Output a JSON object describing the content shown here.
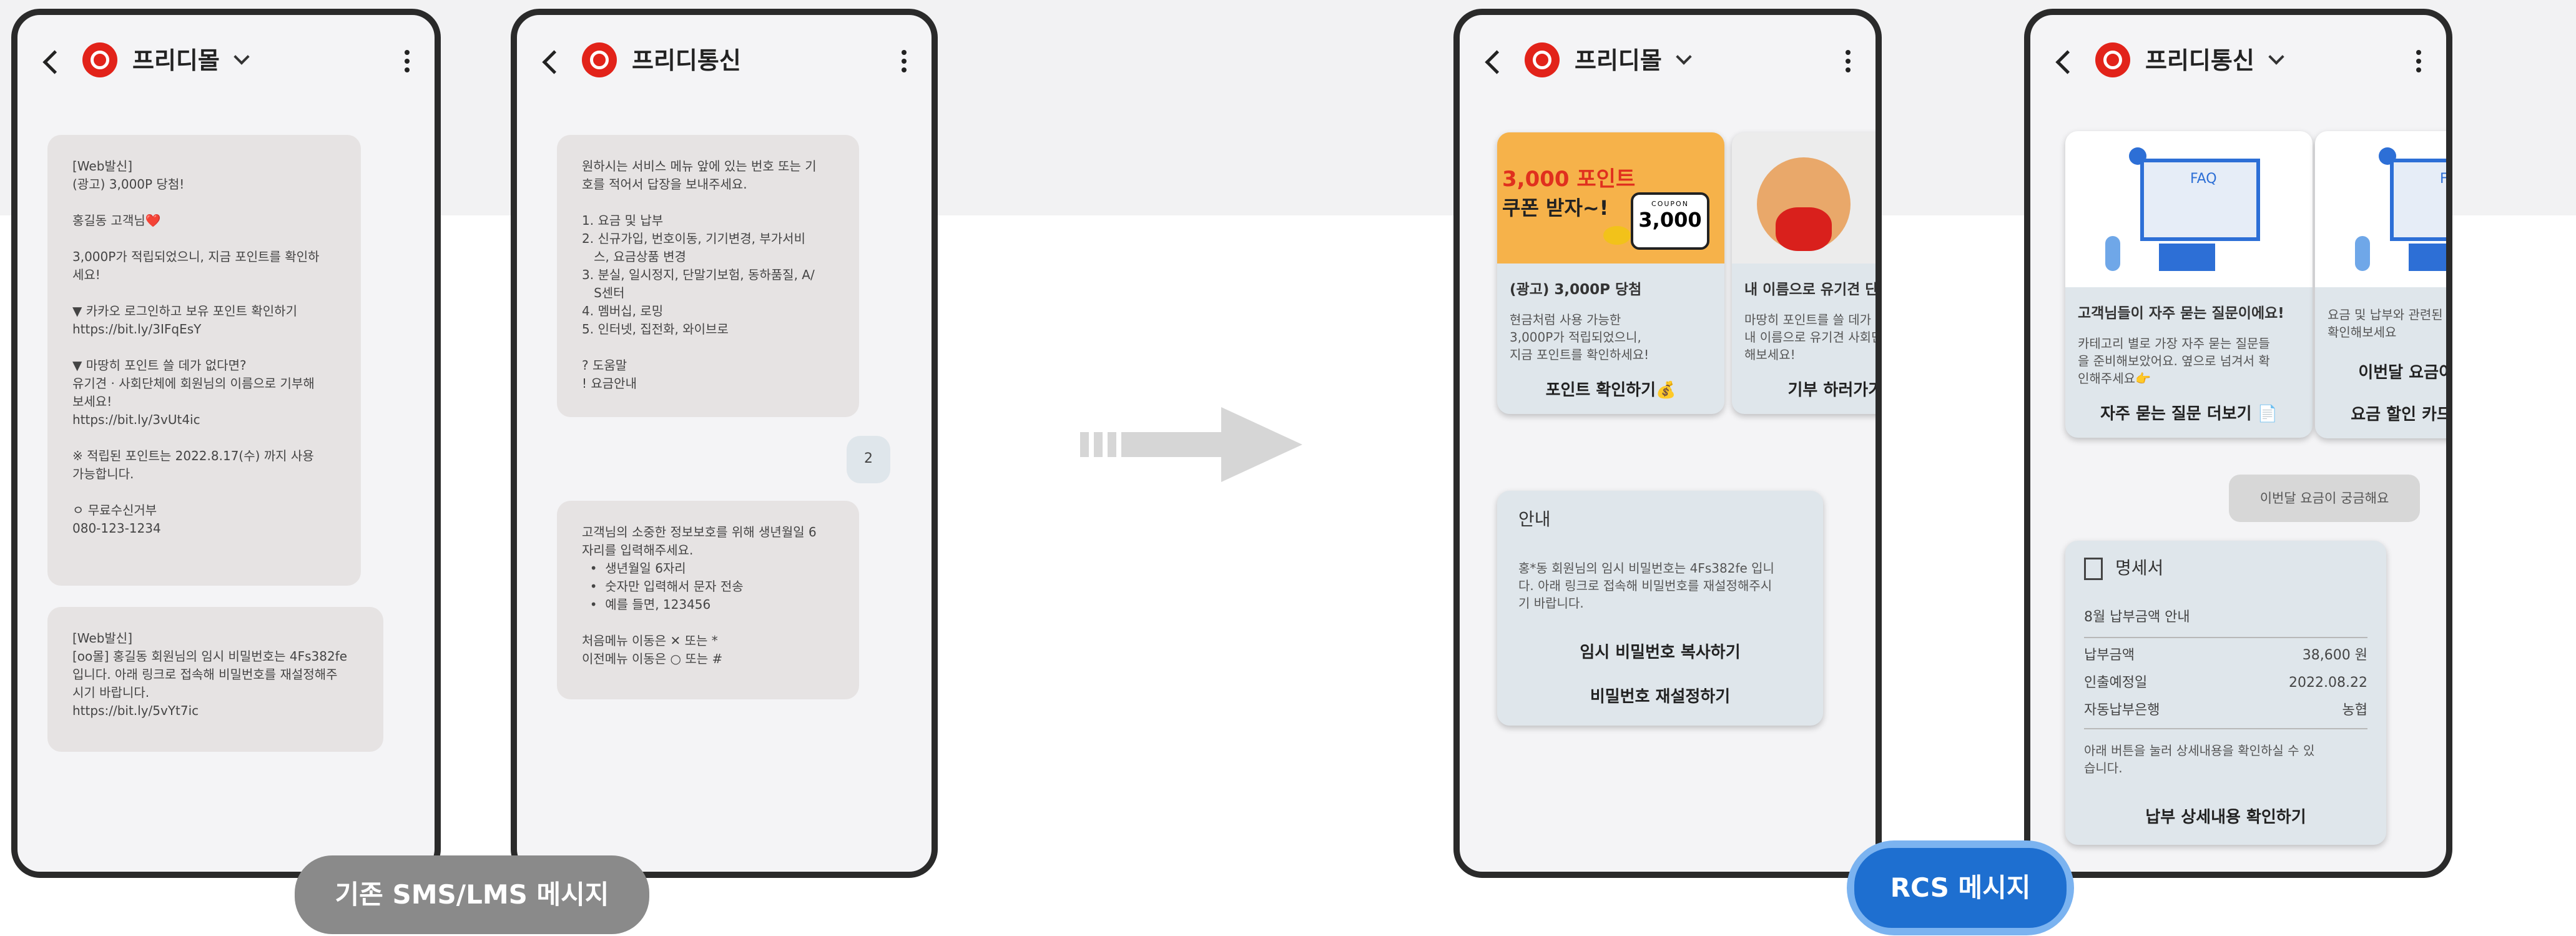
{
  "phones": [
    {
      "title": "프리디몰",
      "has_dropdown": true
    },
    {
      "title": "프리디통신",
      "has_dropdown": false
    },
    {
      "title": "프리디몰",
      "has_dropdown": true
    },
    {
      "title": "프리디통신",
      "has_dropdown": true
    }
  ],
  "sms1": {
    "lines": [
      "[Web발신]",
      "(광고) 3,000P 당첨!",
      "",
      "홍길동 고객님❤️",
      "",
      "3,000P가 적립되었으니, 지금 포인트를 확인하",
      "세요!",
      "",
      "▼ 카카오 로그인하고 보유 포인트 확인하기",
      "https://bit.ly/3IFqEsY",
      "",
      "▼ 마땅히 포인트 쓸 데가 없다면?",
      "유기견 · 사회단체에 회원님의 이름으로 기부해",
      "보세요!",
      "https://bit.ly/3vUt4ic",
      "",
      "※ 적립된 포인트는 2022.8.17(수) 까지 사용",
      "가능합니다.",
      "",
      "ㅇ 무료수신거부",
      "080-123-1234"
    ]
  },
  "sms2": {
    "lines": [
      "[Web발신]",
      "[oo몰] 홍길동 회원님의 임시 비밀번호는 4Fs382fe",
      "입니다. 아래 링크로 접속해 비밀번호를 재설정해주",
      "시기 바랍니다.",
      "https://bit.ly/5vYt7ic"
    ]
  },
  "sms3": {
    "lines": [
      "원하시는 서비스 메뉴 앞에 있는 번호 또는 기",
      "호를 적어서 답장을 보내주세요.",
      "",
      "1. 요금 및 납부",
      "2. 신규가입, 번호이동, 기기변경, 부가서비",
      "   스, 요금상품 변경",
      "3. 분실, 일시정지, 단말기보험, 동하품질, A/",
      "   S센터",
      "4. 멤버십, 로밍",
      "5. 인터넷, 집전화, 와이브로",
      "",
      "? 도움말",
      "! 요금안내"
    ]
  },
  "sms3_reply": "2",
  "sms4": {
    "lines": [
      "고객님의 소중한 정보보호를 위해 생년월일 6",
      "자리를 입력해주세요.",
      "  •  생년월일 6자리",
      "  •  숫자만 입력해서 문자 전송",
      "  •  예를 들면, 123456",
      "",
      "처음메뉴 이동은 ✕ 또는 *",
      "이전메뉴 이동은 ○ 또는 #"
    ]
  },
  "rcs_cards": [
    {
      "img_text_1": "3,000 포인트",
      "img_text_2": "쿠폰 받자~!",
      "coupon_top": "COUPON",
      "coupon_value": "3,000",
      "title": "(광고) 3,000P 당첨",
      "text": [
        "현금처럼 사용 가능한",
        "3,000P가 적립되었으니,",
        "지금 포인트를 확인하세요!"
      ],
      "button": "포인트 확인하기💰"
    },
    {
      "title": "내 이름으로 유기견 단체 기부를?",
      "text": [
        "마땅히 포인트를 쓸 데가 없다면?",
        "내 이름으로 유기견 사회단체에 기부",
        "해보세요!"
      ],
      "button": "기부 하러가기💛"
    }
  ],
  "notice": {
    "header": "안내",
    "text": [
      "홍*동 회원님의 임시 비밀번호는 4Fs382fe 입니",
      "다. 아래 링크로 접속해 비밀번호를 재설정해주시",
      "기 바랍니다."
    ],
    "buttons": [
      "임시 비밀번호 복사하기",
      "비밀번호 재설정하기"
    ]
  },
  "faq_cards": [
    {
      "badge": "FAQ",
      "title": "고객님들이 자주 묻는 질문이에요!",
      "text": [
        "카테고리 별로 가장 자주 묻는 질문들",
        "을 준비해보았어요. 옆으로 넘겨서 확",
        "인해주세요👉"
      ],
      "button": "자주 묻는 질문 더보기 📄"
    },
    {
      "badge": "FAQ",
      "title": "",
      "text": [
        "요금 및 납부와 관련된 문의사항들을",
        "확인해보세요"
      ],
      "buttons": [
        "이번달 요금이 궁금해요",
        "요금 할인 카드는 없나요?"
      ]
    }
  ],
  "chip": "이번달 요금이 궁금해요",
  "receipt": {
    "header": "명세서",
    "subtitle": "8월 납부금액 안내",
    "rows": [
      {
        "label": "납부금액",
        "value": "38,600 원"
      },
      {
        "label": "인출예정일",
        "value": "2022.08.22"
      },
      {
        "label": "자동납부은행",
        "value": "농협"
      }
    ],
    "note": [
      "아래 버튼을 눌러 상세내용을 확인하실 수 있",
      "습니다."
    ],
    "button": "납부 상세내용 확인하기"
  },
  "labels": {
    "sms": "기존 SMS/LMS 메시지",
    "rcs": "RCS 메시지"
  },
  "colors": {
    "sms_pill": "#8a8a8a",
    "rcs_pill": "#1e6fd0",
    "rcs_ring": "#7bb3f0",
    "brand_red": "#e2231a"
  }
}
